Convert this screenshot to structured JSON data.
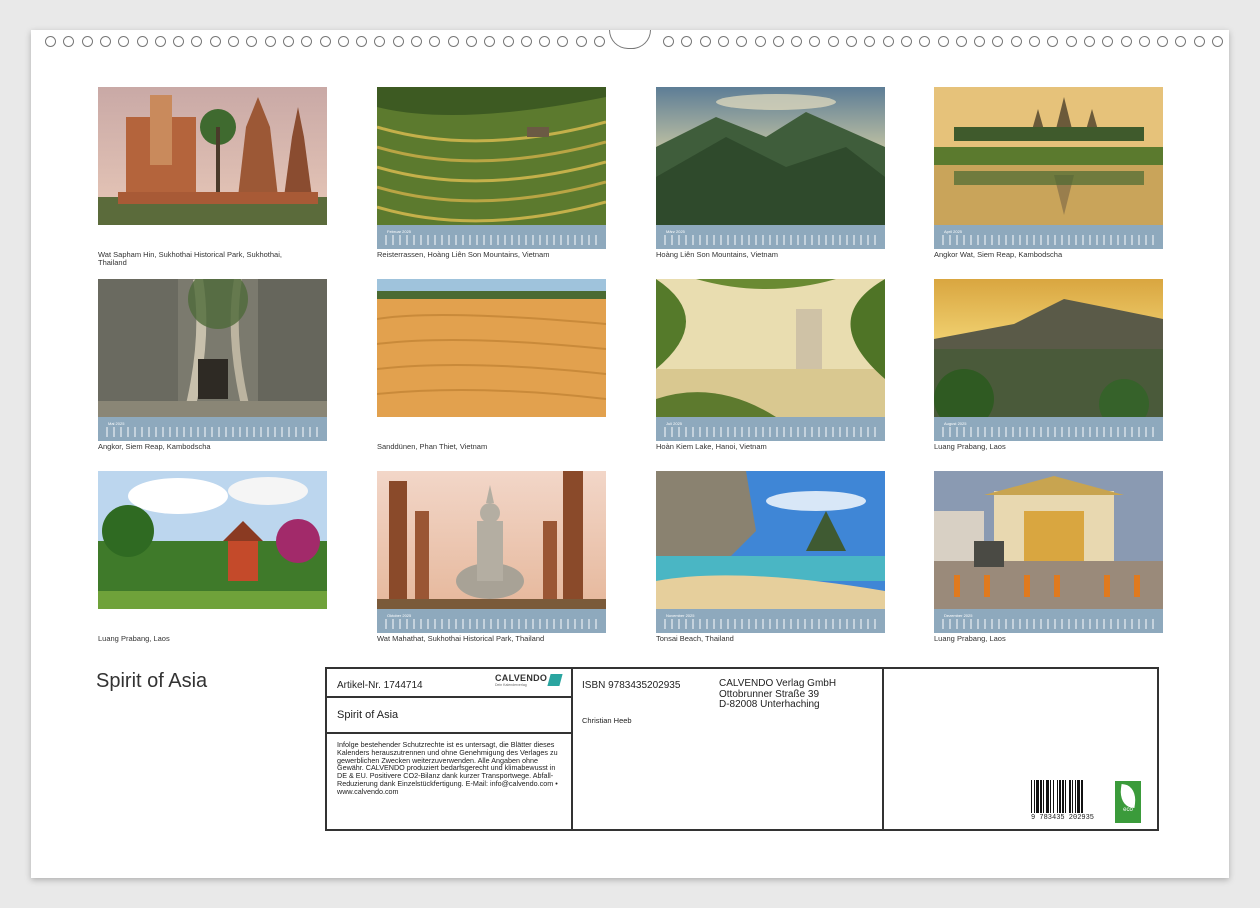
{
  "calendar": {
    "title": "Spirit of Asia",
    "months": [
      {
        "caption": "Wat Sapham Hin, Sukhothai Historical Park, Sukhothai, Thailand",
        "month_label": ""
      },
      {
        "caption": "Reisterrassen, Hoàng Liên Son Mountains, Vietnam",
        "month_label": "Februar 2025"
      },
      {
        "caption": "Hoàng Liên Son Mountains, Vietnam",
        "month_label": "März 2025"
      },
      {
        "caption": "Angkor Wat, Siem Reap, Kambodscha",
        "month_label": "April 2025"
      },
      {
        "caption": "Angkor, Siem Reap, Kambodscha",
        "month_label": "Mai 2025"
      },
      {
        "caption": "Sanddünen, Phan Thiet, Vietnam",
        "month_label": ""
      },
      {
        "caption": "Hoàn Kiem Lake, Hanoi, Vietnam",
        "month_label": "Juli 2025"
      },
      {
        "caption": "Luang Prabang, Laos",
        "month_label": "August 2025"
      },
      {
        "caption": "Luang Prabang, Laos",
        "month_label": ""
      },
      {
        "caption": "Wat Mahathat, Sukhothai Historical Park, Thailand",
        "month_label": "Oktober 2025"
      },
      {
        "caption": "Tonsai Beach, Thailand",
        "month_label": "November 2025"
      },
      {
        "caption": "Luang Prabang, Laos",
        "month_label": "Dezember 2025"
      }
    ]
  },
  "info": {
    "article_label": "Artikel-Nr. 1744714",
    "brand": "CALVENDO",
    "brand_sub": "Dein Kalenderverlag",
    "product_title": "Spirit of Asia",
    "isbn": "ISBN 9783435202935",
    "author": "Christian Heeb",
    "publisher_lines": [
      "CALVENDO Verlag GmbH",
      "Ottobrunner Straße 39",
      "D-82008 Unterhaching"
    ],
    "legal_text": "Infolge bestehender Schutzrechte ist es untersagt, die Blätter dieses Kalenders herauszutrennen und ohne Genehmigung des Verlages zu gewerblichen Zwecken weiterzuverwenden. Alle Angaben ohne Gewähr. CALVENDO produziert bedarfsgerecht und klimabewusst in DE & EU. Positivere CO2-Bilanz dank kurzer Transportwege. Abfall-Reduzierung dank Einzelstückfertigung. E-Mail: info@calvendo.com • www.calvendo.com",
    "barcode_number": "9 783435 202935",
    "eco_label": "eco"
  },
  "colors": {
    "calendar_strip": "#8ea9bd",
    "brand_teal": "#2aa5a0",
    "eco_green": "#3b9b3b"
  }
}
